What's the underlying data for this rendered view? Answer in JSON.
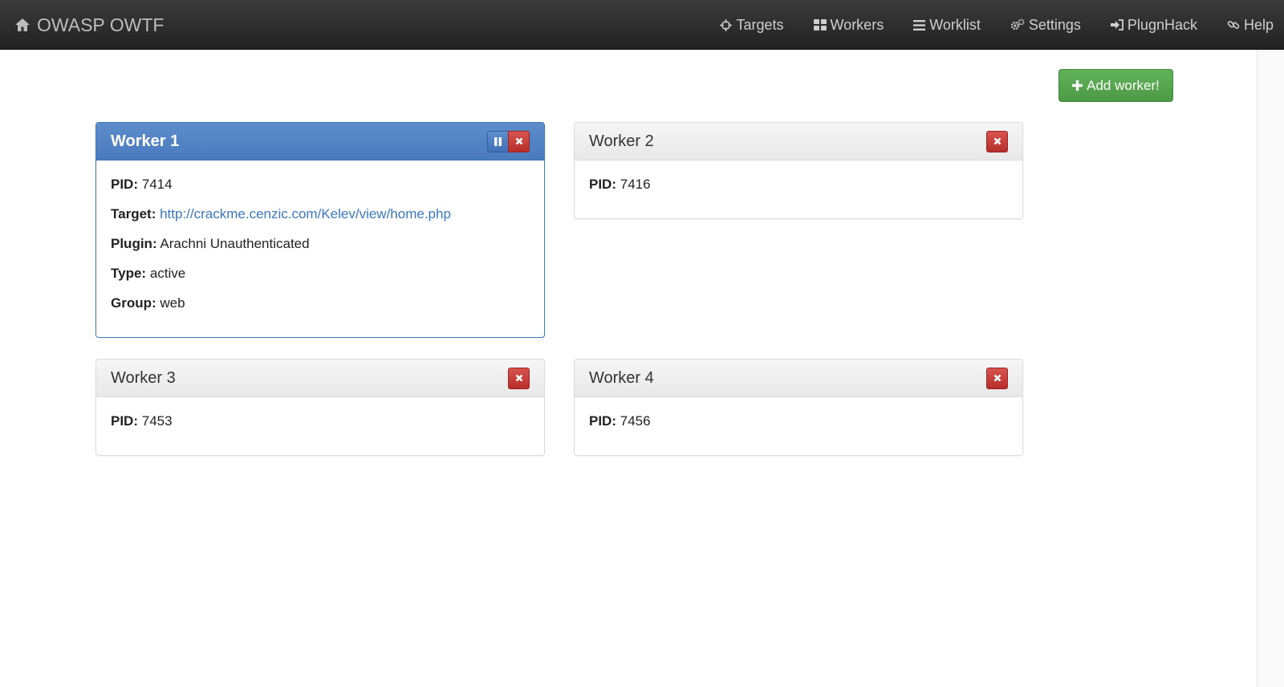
{
  "navbar": {
    "brand": "OWASP OWTF",
    "items": [
      {
        "label": "Targets",
        "icon": "crosshair-icon"
      },
      {
        "label": "Workers",
        "icon": "grid-icon"
      },
      {
        "label": "Worklist",
        "icon": "list-icon"
      },
      {
        "label": "Settings",
        "icon": "gears-icon"
      },
      {
        "label": "PlugnHack",
        "icon": "sign-in-icon"
      },
      {
        "label": "Help",
        "icon": "link-icon"
      }
    ]
  },
  "actions": {
    "add_worker_label": "Add worker!"
  },
  "labels": {
    "pid": "PID:",
    "target": "Target:",
    "plugin": "Plugin:",
    "type": "Type:",
    "group": "Group:"
  },
  "workers": [
    {
      "title": "Worker 1",
      "pid": "7414",
      "target": "http://crackme.cenzic.com/Kelev/view/home.php",
      "plugin": "Arachni Unauthenticated",
      "type": "active",
      "group": "web",
      "running": true
    },
    {
      "title": "Worker 2",
      "pid": "7416"
    },
    {
      "title": "Worker 3",
      "pid": "7453"
    },
    {
      "title": "Worker 4",
      "pid": "7456"
    }
  ],
  "colors": {
    "navbar": "#2b2b2b",
    "primary": "#4a7bbd",
    "success": "#5cb85c",
    "danger": "#c9302c",
    "link": "#3a78c3"
  }
}
